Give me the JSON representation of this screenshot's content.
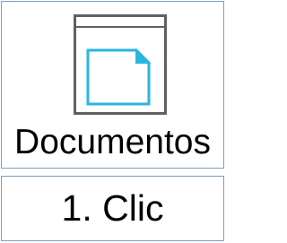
{
  "ribbon_button": {
    "label": "Documentos",
    "icon": "document-window-icon",
    "colors": {
      "frame": "#606060",
      "document": "#29b6e0",
      "border": "#7f9db9"
    }
  },
  "step": {
    "text": "1. Clic"
  }
}
